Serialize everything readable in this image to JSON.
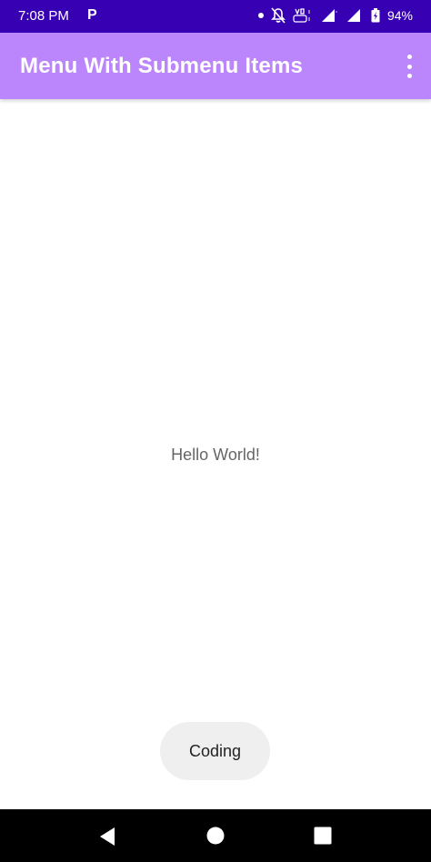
{
  "status_bar": {
    "time": "7:08 PM",
    "app_icon": "P",
    "battery": "94%",
    "icons": [
      "notification-dot",
      "bell-off-icon",
      "volte-icon",
      "signal-icon",
      "signal-icon-2",
      "battery-charging-icon"
    ]
  },
  "app_bar": {
    "title": "Menu With Submenu Items",
    "overflow_icon": "more-vert-icon"
  },
  "main": {
    "text": "Hello World!"
  },
  "toast": {
    "text": "Coding"
  },
  "nav_bar": {
    "icons": [
      "back-icon",
      "home-icon",
      "recents-icon"
    ]
  },
  "colors": {
    "status_bar": "#3700b3",
    "app_bar": "#bb86fc",
    "toast_bg": "#efefef",
    "nav_bar": "#000000"
  }
}
